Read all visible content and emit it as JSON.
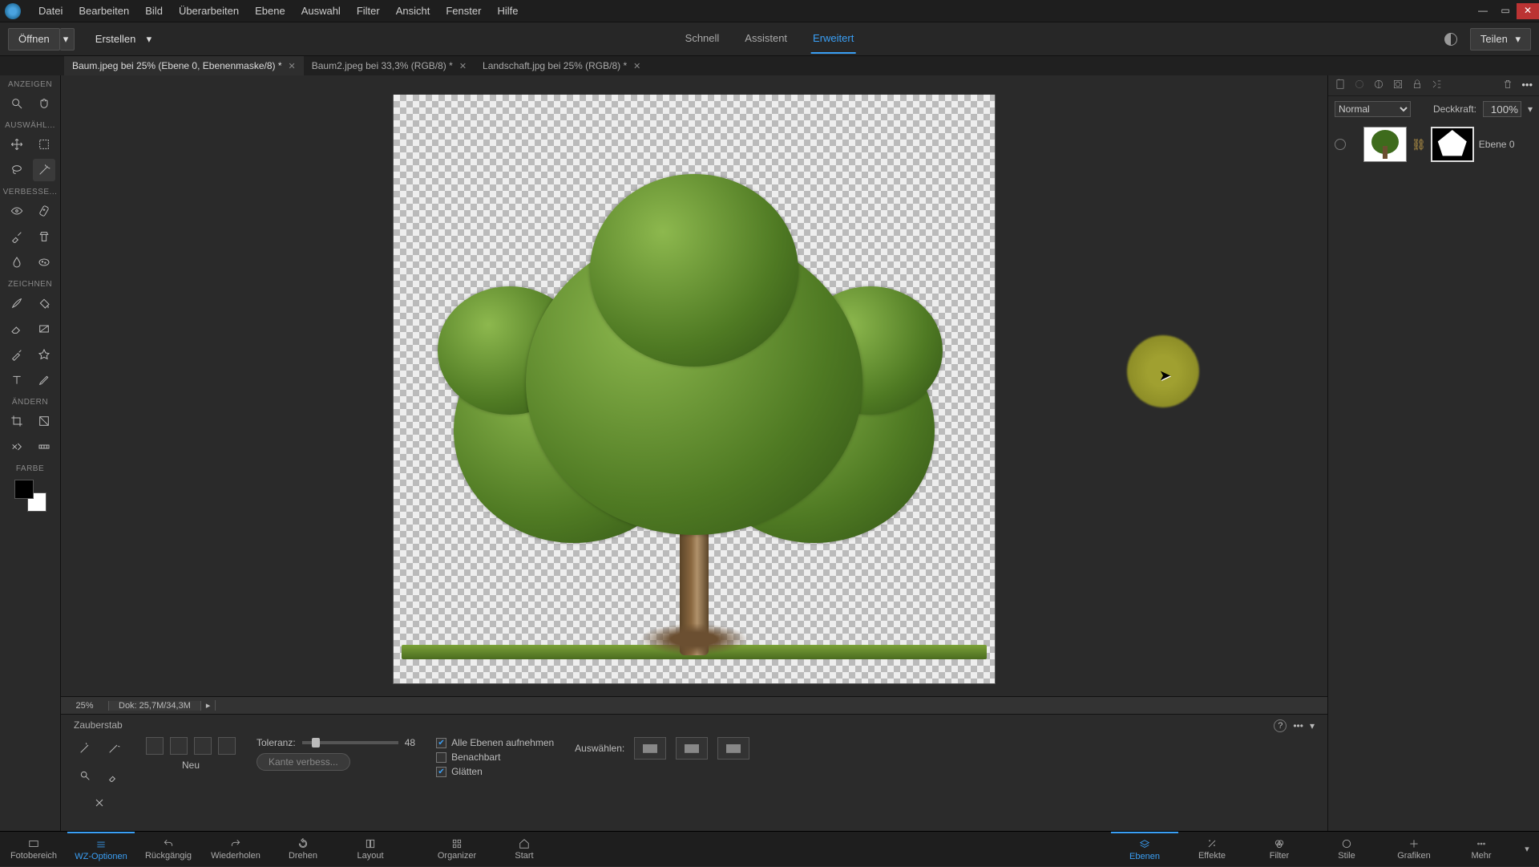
{
  "menu": [
    "Datei",
    "Bearbeiten",
    "Bild",
    "Überarbeiten",
    "Ebene",
    "Auswahl",
    "Filter",
    "Ansicht",
    "Fenster",
    "Hilfe"
  ],
  "secondbar": {
    "open": "Öffnen",
    "create": "Erstellen",
    "share": "Teilen",
    "tabs": {
      "quick": "Schnell",
      "assistant": "Assistent",
      "expert": "Erweitert"
    }
  },
  "doc_tabs": [
    {
      "label": "Baum.jpeg bei 25% (Ebene 0, Ebenenmaske/8) *",
      "active": true
    },
    {
      "label": "Baum2.jpeg bei 33,3% (RGB/8) *",
      "active": false
    },
    {
      "label": "Landschaft.jpg bei 25% (RGB/8) *",
      "active": false
    }
  ],
  "toolbox": {
    "sections": {
      "view": "ANZEIGEN",
      "select": "AUSWÄHL...",
      "enhance": "VERBESSE...",
      "draw": "ZEICHNEN",
      "modify": "ÄNDERN",
      "color": "FARBE"
    }
  },
  "status": {
    "zoom": "25%",
    "doc": "Dok: 25,7M/34,3M"
  },
  "tooloptions": {
    "title": "Zauberstab",
    "mode_label": "Neu",
    "tolerance_label": "Toleranz:",
    "tolerance_value": "48",
    "all_layers": "Alle Ebenen aufnehmen",
    "contiguous": "Benachbart",
    "antialias": "Glätten",
    "refine": "Kante verbess...",
    "select_label": "Auswählen:"
  },
  "layers": {
    "blend": "Normal",
    "opacity_label": "Deckkraft:",
    "opacity": "100%",
    "layer0": "Ebene 0"
  },
  "taskbar_left": [
    "Fotobereich",
    "WZ-Optionen",
    "Rückgängig",
    "Wiederholen",
    "Drehen",
    "Layout",
    "Organizer",
    "Start"
  ],
  "taskbar_right": [
    "Ebenen",
    "Effekte",
    "Filter",
    "Stile",
    "Grafiken",
    "Mehr"
  ]
}
